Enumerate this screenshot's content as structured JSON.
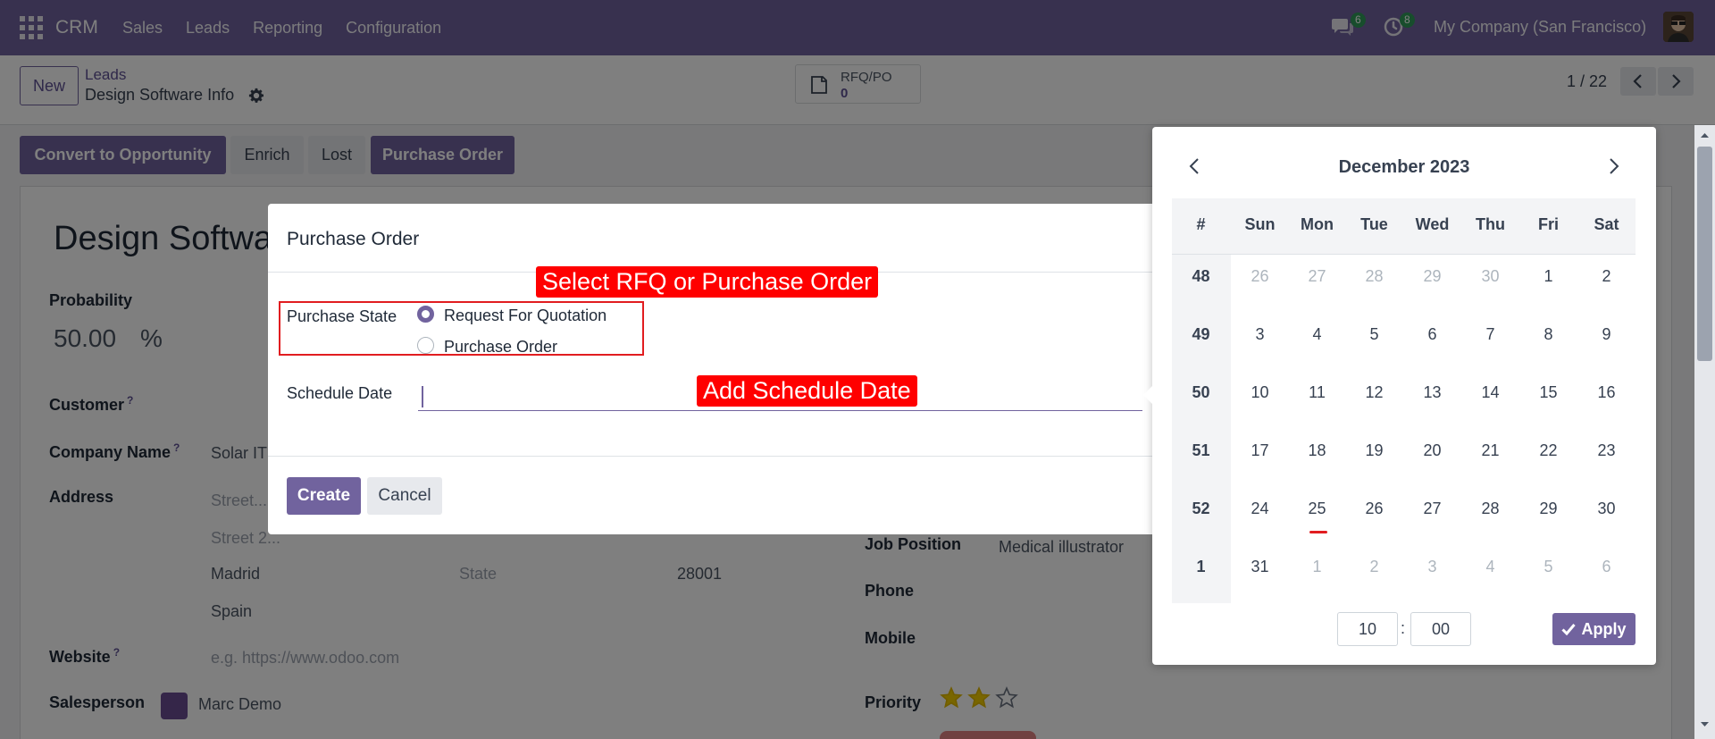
{
  "navbar": {
    "brand": "CRM",
    "menu": [
      "Sales",
      "Leads",
      "Reporting",
      "Configuration"
    ],
    "chat_badge": "6",
    "activity_badge": "8",
    "company": "My Company (San Francisco)"
  },
  "control": {
    "new_label": "New",
    "breadcrumb_parent": "Leads",
    "breadcrumb_current": "Design Software Info",
    "rfq_label": "RFQ/PO",
    "rfq_count": "0",
    "pager": "1 / 22"
  },
  "actions": [
    "Convert to Opportunity",
    "Enrich",
    "Lost",
    "Purchase Order"
  ],
  "form": {
    "title": "Design Softwa",
    "probability_label": "Probability",
    "probability_value": "50.00",
    "probability_unit": "%",
    "customer_label": "Customer",
    "company_label": "Company Name",
    "company_value": "Solar IT",
    "address_label": "Address",
    "street_placeholder": "Street...",
    "street2_placeholder": "Street 2...",
    "city": "Madrid",
    "state_placeholder": "State",
    "zip": "28001",
    "country": "Spain",
    "website_label": "Website",
    "website_placeholder": "e.g. https://www.odoo.com",
    "salesperson_label": "Salesperson",
    "salesperson_value": "Marc Demo",
    "job_label": "Job Position",
    "job_value": "Medical illustrator",
    "phone_label": "Phone",
    "mobile_label": "Mobile",
    "priority_label": "Priority",
    "priority_stars": 2,
    "priority_max": 3,
    "help_mark": "?"
  },
  "modal": {
    "title": "Purchase Order",
    "state_label": "Purchase State",
    "option_rfq": "Request For Quotation",
    "option_po": "Purchase Order",
    "selected": "rfq",
    "schedule_label": "Schedule Date",
    "schedule_value": "",
    "create_label": "Create",
    "cancel_label": "Cancel",
    "callout_state": "Select RFQ or Purchase Order",
    "callout_date": "Add Schedule Date"
  },
  "datepicker": {
    "month_label": "December 2023",
    "week_header": "#",
    "weekdays": [
      "Sun",
      "Mon",
      "Tue",
      "Wed",
      "Thu",
      "Fri",
      "Sat"
    ],
    "weeks": [
      {
        "num": "48",
        "days": [
          "26",
          "27",
          "28",
          "29",
          "30",
          "1",
          "2"
        ],
        "muted": [
          true,
          true,
          true,
          true,
          true,
          false,
          false
        ]
      },
      {
        "num": "49",
        "days": [
          "3",
          "4",
          "5",
          "6",
          "7",
          "8",
          "9"
        ],
        "muted": [
          false,
          false,
          false,
          false,
          false,
          false,
          false
        ]
      },
      {
        "num": "50",
        "days": [
          "10",
          "11",
          "12",
          "13",
          "14",
          "15",
          "16"
        ],
        "muted": [
          false,
          false,
          false,
          false,
          false,
          false,
          false
        ]
      },
      {
        "num": "51",
        "days": [
          "17",
          "18",
          "19",
          "20",
          "21",
          "22",
          "23"
        ],
        "muted": [
          false,
          false,
          false,
          false,
          false,
          false,
          false
        ]
      },
      {
        "num": "52",
        "days": [
          "24",
          "25",
          "26",
          "27",
          "28",
          "29",
          "30"
        ],
        "muted": [
          false,
          false,
          false,
          false,
          false,
          false,
          false
        ]
      },
      {
        "num": "1",
        "days": [
          "31",
          "1",
          "2",
          "3",
          "4",
          "5",
          "6"
        ],
        "muted": [
          false,
          true,
          true,
          true,
          true,
          true,
          true
        ]
      }
    ],
    "hour": "10",
    "minute": "00",
    "apply_label": "Apply"
  },
  "colors": {
    "brand": "#71639e",
    "callout": "#ff0000",
    "today_marker": "#e11d20"
  }
}
